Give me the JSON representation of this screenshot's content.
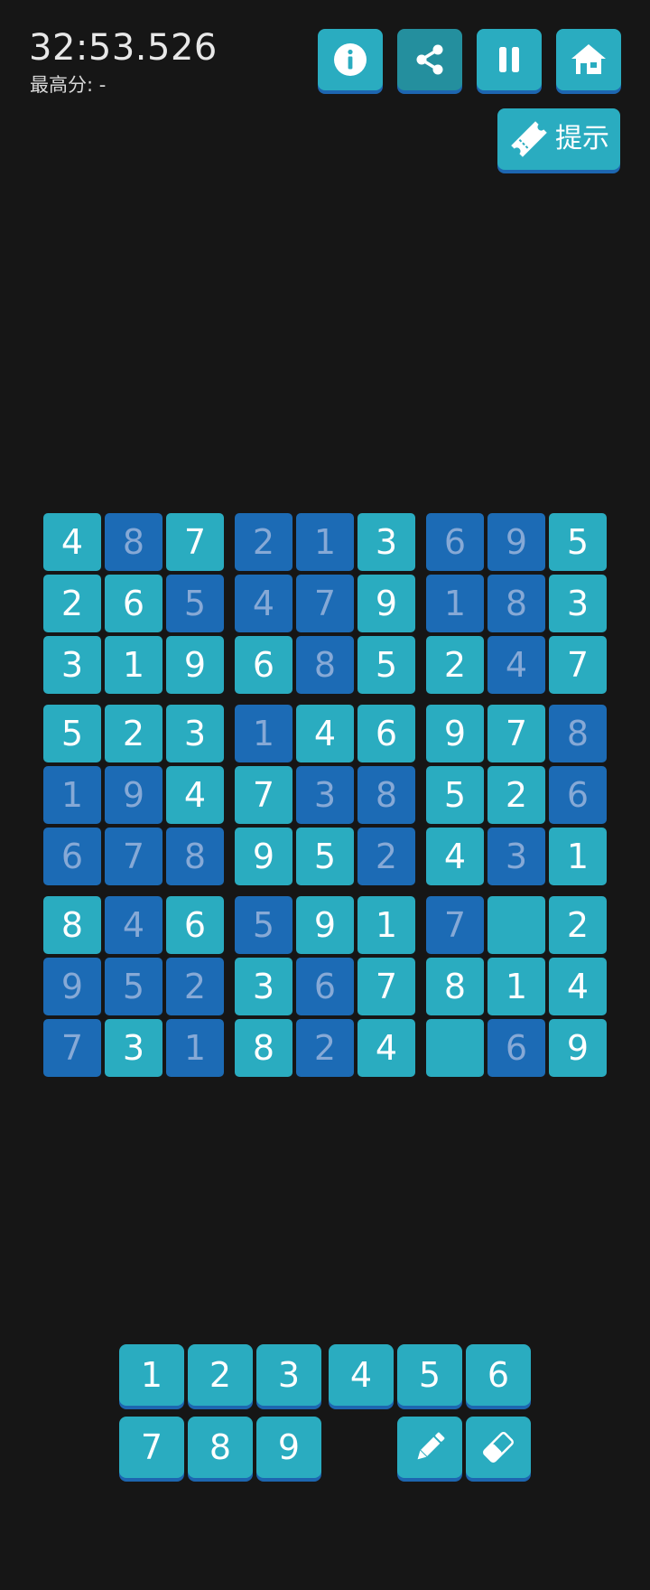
{
  "header": {
    "timer": "32:53.526",
    "best_score_label": "最高分: -"
  },
  "toolbar": {
    "info_icon": "info-icon",
    "share_icon": "share-icon",
    "pause_icon": "pause-icon",
    "home_icon": "home-icon",
    "hint_label": "提示",
    "hint_icon": "ticket-icon",
    "active_button": "share"
  },
  "colors": {
    "background": "#161616",
    "given_cell": "#2aacc0",
    "filled_cell": "#1c6bb5",
    "filled_text": "#86a9d6",
    "button_shadow": "#1d66b0"
  },
  "board": {
    "rows": [
      [
        {
          "v": "4",
          "t": "given"
        },
        {
          "v": "8",
          "t": "filled"
        },
        {
          "v": "7",
          "t": "given"
        },
        {
          "v": "2",
          "t": "filled"
        },
        {
          "v": "1",
          "t": "filled"
        },
        {
          "v": "3",
          "t": "given"
        },
        {
          "v": "6",
          "t": "filled"
        },
        {
          "v": "9",
          "t": "filled"
        },
        {
          "v": "5",
          "t": "given"
        }
      ],
      [
        {
          "v": "2",
          "t": "given"
        },
        {
          "v": "6",
          "t": "given"
        },
        {
          "v": "5",
          "t": "filled"
        },
        {
          "v": "4",
          "t": "filled"
        },
        {
          "v": "7",
          "t": "filled"
        },
        {
          "v": "9",
          "t": "given"
        },
        {
          "v": "1",
          "t": "filled"
        },
        {
          "v": "8",
          "t": "filled"
        },
        {
          "v": "3",
          "t": "given"
        }
      ],
      [
        {
          "v": "3",
          "t": "given"
        },
        {
          "v": "1",
          "t": "given"
        },
        {
          "v": "9",
          "t": "given"
        },
        {
          "v": "6",
          "t": "given"
        },
        {
          "v": "8",
          "t": "filled"
        },
        {
          "v": "5",
          "t": "given"
        },
        {
          "v": "2",
          "t": "given"
        },
        {
          "v": "4",
          "t": "filled"
        },
        {
          "v": "7",
          "t": "given"
        }
      ],
      [
        {
          "v": "5",
          "t": "given"
        },
        {
          "v": "2",
          "t": "given"
        },
        {
          "v": "3",
          "t": "given"
        },
        {
          "v": "1",
          "t": "filled"
        },
        {
          "v": "4",
          "t": "given"
        },
        {
          "v": "6",
          "t": "given"
        },
        {
          "v": "9",
          "t": "given"
        },
        {
          "v": "7",
          "t": "given"
        },
        {
          "v": "8",
          "t": "filled"
        }
      ],
      [
        {
          "v": "1",
          "t": "filled"
        },
        {
          "v": "9",
          "t": "filled"
        },
        {
          "v": "4",
          "t": "given"
        },
        {
          "v": "7",
          "t": "given"
        },
        {
          "v": "3",
          "t": "filled"
        },
        {
          "v": "8",
          "t": "filled"
        },
        {
          "v": "5",
          "t": "given"
        },
        {
          "v": "2",
          "t": "given"
        },
        {
          "v": "6",
          "t": "filled"
        }
      ],
      [
        {
          "v": "6",
          "t": "filled"
        },
        {
          "v": "7",
          "t": "filled"
        },
        {
          "v": "8",
          "t": "filled"
        },
        {
          "v": "9",
          "t": "given"
        },
        {
          "v": "5",
          "t": "given"
        },
        {
          "v": "2",
          "t": "filled"
        },
        {
          "v": "4",
          "t": "given"
        },
        {
          "v": "3",
          "t": "filled"
        },
        {
          "v": "1",
          "t": "given"
        }
      ],
      [
        {
          "v": "8",
          "t": "given"
        },
        {
          "v": "4",
          "t": "filled"
        },
        {
          "v": "6",
          "t": "given"
        },
        {
          "v": "5",
          "t": "filled"
        },
        {
          "v": "9",
          "t": "given"
        },
        {
          "v": "1",
          "t": "given"
        },
        {
          "v": "7",
          "t": "filled"
        },
        {
          "v": "",
          "t": "given"
        },
        {
          "v": "2",
          "t": "given"
        }
      ],
      [
        {
          "v": "9",
          "t": "filled"
        },
        {
          "v": "5",
          "t": "filled"
        },
        {
          "v": "2",
          "t": "filled"
        },
        {
          "v": "3",
          "t": "given"
        },
        {
          "v": "6",
          "t": "filled"
        },
        {
          "v": "7",
          "t": "given"
        },
        {
          "v": "8",
          "t": "given"
        },
        {
          "v": "1",
          "t": "given"
        },
        {
          "v": "4",
          "t": "given"
        }
      ],
      [
        {
          "v": "7",
          "t": "filled"
        },
        {
          "v": "3",
          "t": "given"
        },
        {
          "v": "1",
          "t": "filled"
        },
        {
          "v": "8",
          "t": "given"
        },
        {
          "v": "2",
          "t": "filled"
        },
        {
          "v": "4",
          "t": "given"
        },
        {
          "v": "",
          "t": "given"
        },
        {
          "v": "6",
          "t": "filled"
        },
        {
          "v": "9",
          "t": "given"
        }
      ]
    ]
  },
  "keypad": {
    "row1": [
      "1",
      "2",
      "3",
      "4",
      "5",
      "6"
    ],
    "row2": [
      "7",
      "8",
      "9"
    ],
    "pencil_icon": "pencil-icon",
    "eraser_icon": "eraser-icon"
  }
}
